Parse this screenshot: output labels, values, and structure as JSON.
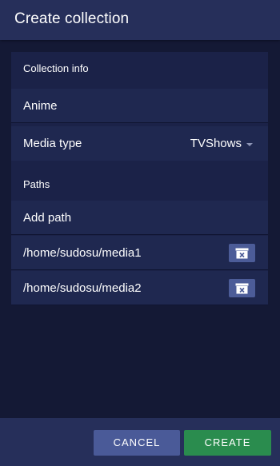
{
  "header": {
    "title": "Create collection"
  },
  "collection_info": {
    "label": "Collection info",
    "name_value": "Anime",
    "media_type_label": "Media type",
    "media_type_value": "TVShows"
  },
  "paths": {
    "label": "Paths",
    "add_path_label": "Add path",
    "items": [
      {
        "path": "/home/sudosu/media1"
      },
      {
        "path": "/home/sudosu/media2"
      }
    ]
  },
  "footer": {
    "cancel_label": "CANCEL",
    "create_label": "CREATE"
  },
  "colors": {
    "background": "#141935",
    "header": "#262f5a",
    "row": "#1f2850",
    "cancel_button": "#4a5a98",
    "create_button": "#2a8c4e"
  }
}
